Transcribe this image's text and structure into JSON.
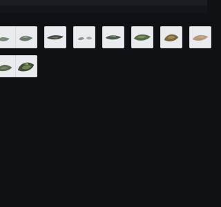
{
  "toolbar": {
    "bar_color": "#1a1d22",
    "subbar_color": "#12151a"
  },
  "gallery": {
    "background": "#0f1114",
    "thumbnail_background": "#e9ebee",
    "items": [
      {
        "id": "thumb-1",
        "icon": "plant-specimen-icon",
        "tone": "#7b8a7a"
      },
      {
        "id": "thumb-2",
        "icon": "plant-specimen-icon",
        "tone": "#6d7a6a"
      },
      {
        "id": "thumb-3",
        "icon": "plant-specimen-icon",
        "tone": "#3f4a3e"
      },
      {
        "id": "thumb-4",
        "icon": "plant-specimen-icon",
        "tone": "#8a9789"
      },
      {
        "id": "thumb-5",
        "icon": "plant-specimen-icon",
        "tone": "#4a5a4a"
      },
      {
        "id": "thumb-6",
        "icon": "plant-specimen-icon",
        "tone": "#556b47"
      },
      {
        "id": "thumb-7",
        "icon": "plant-specimen-icon",
        "tone": "#7a6a3f"
      },
      {
        "id": "thumb-8",
        "icon": "plant-specimen-icon",
        "tone": "#b69a7a"
      },
      {
        "id": "thumb-9",
        "icon": "plant-specimen-icon",
        "tone": "#5d6b50"
      },
      {
        "id": "thumb-10",
        "icon": "plant-specimen-icon",
        "tone": "#3e4f35"
      }
    ]
  }
}
